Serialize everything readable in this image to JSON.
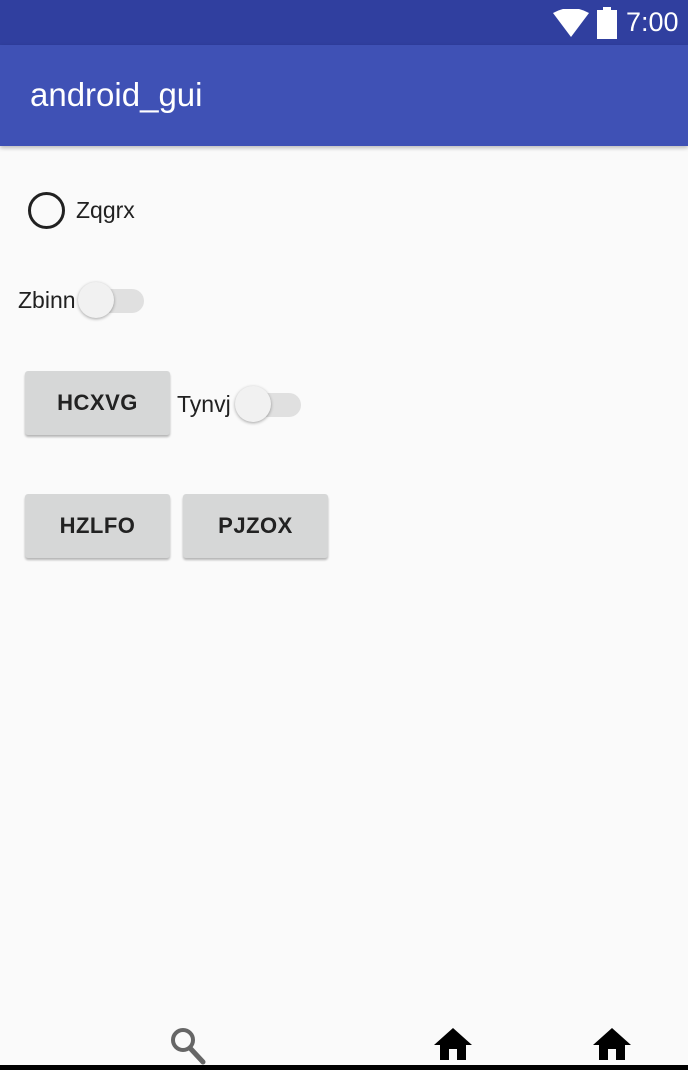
{
  "status_bar": {
    "time": "7:00",
    "icons": [
      "wifi-icon",
      "battery-icon"
    ]
  },
  "app_bar": {
    "title": "android_gui"
  },
  "content": {
    "radio": {
      "label": "Zqgrx",
      "checked": false
    },
    "switch_1": {
      "label": "Zbinn",
      "on": false
    },
    "button_1": {
      "label": "HCXVG"
    },
    "switch_2": {
      "label": "Tynvj",
      "on": false
    },
    "button_2": {
      "label": "HZLFO"
    },
    "button_3": {
      "label": "PJZOX"
    }
  },
  "nav_bar": {
    "icons": [
      "search-icon",
      "home-icon",
      "home-icon"
    ]
  },
  "colors": {
    "status_bar": "#303f9f",
    "app_bar": "#3f51b5",
    "background": "#fafafa",
    "button": "#d6d7d7"
  }
}
